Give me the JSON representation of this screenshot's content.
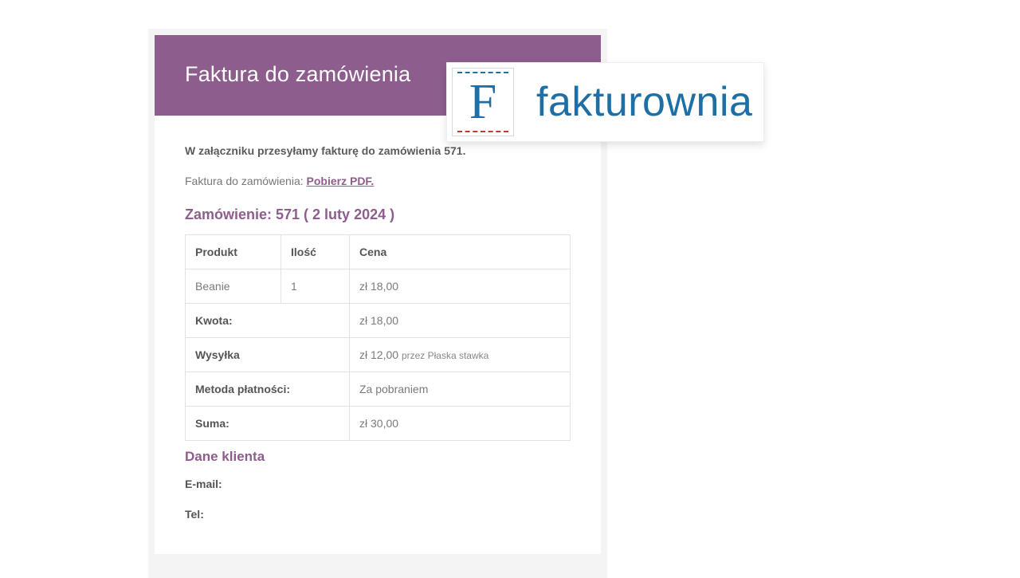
{
  "banner": {
    "title": "Faktura do zamówienia"
  },
  "intro": "W załączniku przesyłamy fakturę do zamówienia 571.",
  "download": {
    "prefix": "Faktura do zamówienia:",
    "link_label": "Pobierz PDF."
  },
  "order": {
    "heading": "Zamówienie: 571 ( 2 luty 2024 )",
    "columns": {
      "product": "Produkt",
      "qty": "Ilość",
      "price": "Cena"
    },
    "items": [
      {
        "product": "Beanie",
        "qty": "1",
        "price": "zł 18,00"
      }
    ],
    "totals": {
      "subtotal_label": "Kwota:",
      "subtotal_value": "zł 18,00",
      "shipping_label": "Wysyłka",
      "shipping_value": "zł 12,00",
      "shipping_extra": "przez Płaska stawka",
      "payment_label": "Metoda płatności:",
      "payment_value": "Za pobraniem",
      "sum_label": "Suma:",
      "sum_value": "zł 30,00"
    }
  },
  "client": {
    "heading": "Dane klienta",
    "email_label": "E-mail:",
    "tel_label": "Tel:"
  },
  "logo": {
    "letter": "F",
    "word": "fakturownia"
  }
}
